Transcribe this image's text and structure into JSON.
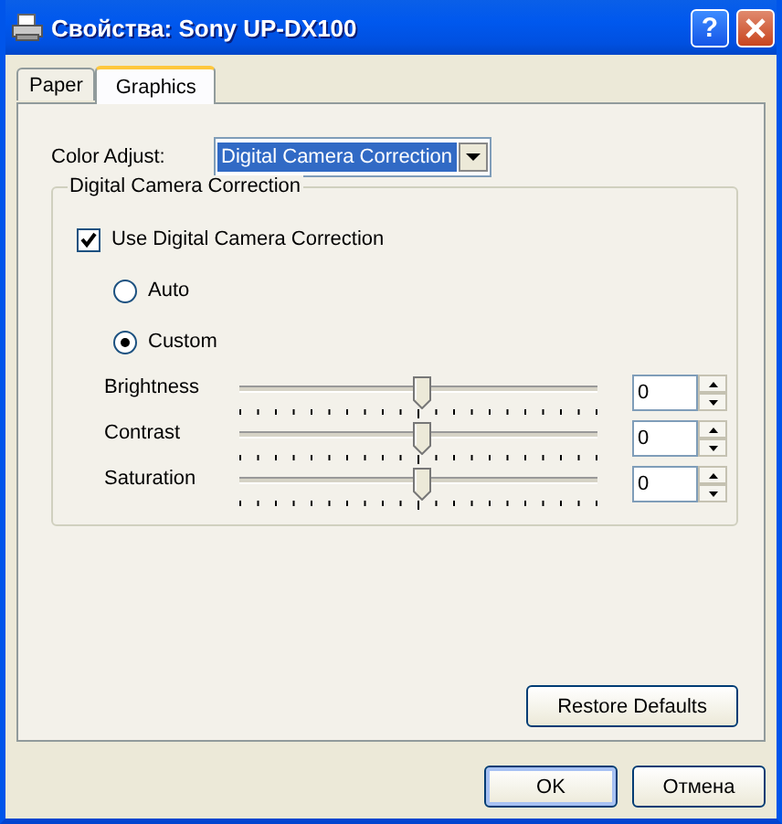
{
  "window": {
    "title": "Свойства: Sony UP-DX100",
    "help_button": "?"
  },
  "tabs": [
    {
      "label": "Paper",
      "selected": false
    },
    {
      "label": "Graphics",
      "selected": true
    }
  ],
  "color_adjust": {
    "label": "Color Adjust:",
    "value": "Digital Camera Correction"
  },
  "group": {
    "title": "Digital Camera Correction",
    "checkbox": {
      "label": "Use Digital Camera Correction",
      "checked": true
    },
    "radios": [
      {
        "label": "Auto",
        "selected": false
      },
      {
        "label": "Custom",
        "selected": true
      }
    ],
    "sliders": [
      {
        "name": "Brightness",
        "level": 0.51,
        "value": "0"
      },
      {
        "name": "Contrast",
        "level": 0.51,
        "value": "0"
      },
      {
        "name": "Saturation",
        "level": 0.51,
        "value": "0"
      }
    ]
  },
  "restore_button": "Restore Defaults",
  "buttons": [
    {
      "label": "OK",
      "kind": "default"
    },
    {
      "label": "Отмена",
      "kind": "normal"
    }
  ]
}
